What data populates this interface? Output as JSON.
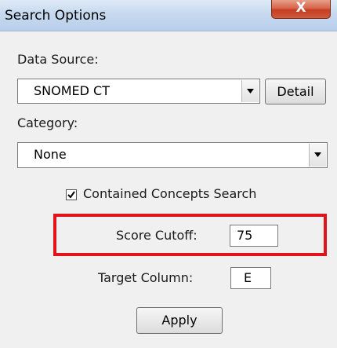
{
  "window": {
    "title": "Search Options",
    "close_glyph": "X"
  },
  "data_source": {
    "label": "Data Source:",
    "selected": "SNOMED CT",
    "detail_button": "Detail"
  },
  "category": {
    "label": "Category:",
    "selected": "None"
  },
  "contained_concepts": {
    "label": "Contained Concepts Search",
    "checked": true
  },
  "score_cutoff": {
    "label": "Score Cutoff:",
    "value": "75"
  },
  "target_column": {
    "label": "Target Column:",
    "value": "E"
  },
  "apply_button": {
    "label": "Apply"
  },
  "colors": {
    "highlight": "#e2141b",
    "close_button": "#c9462b"
  },
  "icons": [
    "close-icon",
    "dropdown-arrow-icon",
    "checkmark-icon"
  ]
}
